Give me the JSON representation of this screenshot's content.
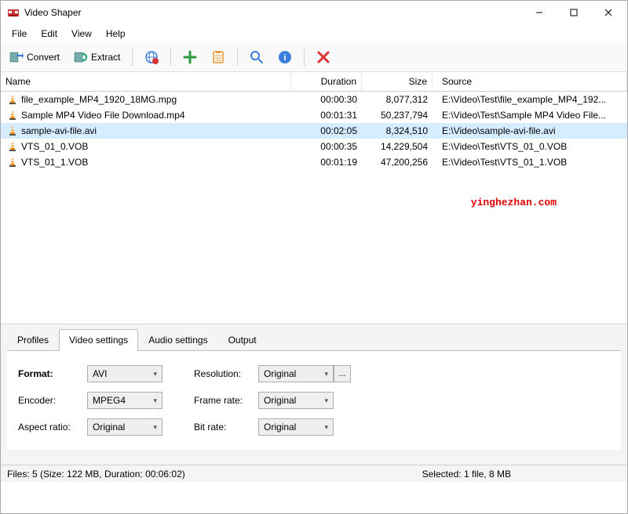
{
  "window": {
    "title": "Video Shaper"
  },
  "menu": {
    "file": "File",
    "edit": "Edit",
    "view": "View",
    "help": "Help"
  },
  "toolbar": {
    "convert": "Convert",
    "extract": "Extract"
  },
  "columns": {
    "name": "Name",
    "duration": "Duration",
    "size": "Size",
    "source": "Source"
  },
  "files": [
    {
      "name": "file_example_MP4_1920_18MG.mpg",
      "duration": "00:00:30",
      "size": "8,077,312",
      "source": "E:\\Video\\Test\\file_example_MP4_192..."
    },
    {
      "name": "Sample MP4 Video File Download.mp4",
      "duration": "00:01:31",
      "size": "50,237,794",
      "source": "E:\\Video\\Test\\Sample MP4 Video File..."
    },
    {
      "name": "sample-avi-file.avi",
      "duration": "00:02:05",
      "size": "8,324,510",
      "source": "E:\\Video\\sample-avi-file.avi"
    },
    {
      "name": "VTS_01_0.VOB",
      "duration": "00:00:35",
      "size": "14,229,504",
      "source": "E:\\Video\\Test\\VTS_01_0.VOB"
    },
    {
      "name": "VTS_01_1.VOB",
      "duration": "00:01:19",
      "size": "47,200,256",
      "source": "E:\\Video\\Test\\VTS_01_1.VOB"
    }
  ],
  "selected_index": 2,
  "watermark": "yinghezhan.com",
  "tabs": {
    "profiles": "Profiles",
    "video": "Video settings",
    "audio": "Audio settings",
    "output": "Output"
  },
  "settings": {
    "format_label": "Format:",
    "format_value": "AVI",
    "encoder_label": "Encoder:",
    "encoder_value": "MPEG4",
    "aspect_label": "Aspect ratio:",
    "aspect_value": "Original",
    "resolution_label": "Resolution:",
    "resolution_value": "Original",
    "framerate_label": "Frame rate:",
    "framerate_value": "Original",
    "bitrate_label": "Bit rate:",
    "bitrate_value": "Original",
    "ellipsis": "..."
  },
  "status": {
    "left": "Files: 5 (Size: 122 MB, Duration: 00:06:02)",
    "right": "Selected: 1 file, 8 MB"
  }
}
